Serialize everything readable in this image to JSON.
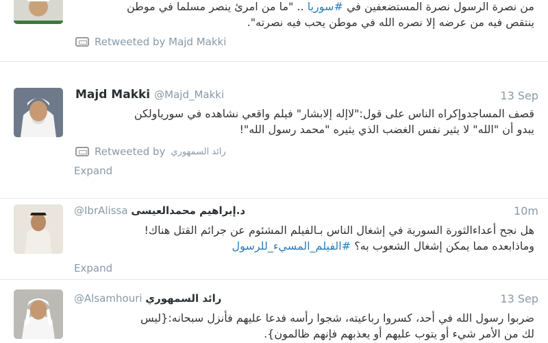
{
  "tweets": [
    {
      "line1_start": "من نصرة الرسول نصرة المستضعفين في ",
      "line1_tag": "#سوريا",
      "line1_end": " .. \"ما من امرئ ينصر مسلما في موطن",
      "line2": "ينتقص فيه من عرضه إلا نصره الله في موطن يحب فيه نصرته\".",
      "retweet_label": "Retweeted by Majd Makki"
    },
    {
      "name": "Majd Makki",
      "handle": "@Majd_Makki",
      "time": "13 Sep",
      "line1": "قصف المساجدوإكراه الناس على قول:\"لاإله إلابشار\" فيلم واقعي نشاهده في سورياولكن",
      "line2": "يبدو أن \"الله\" لا يثير نفس الغضب الذي يثيره \"محمد رسول الله\"!",
      "retweet_label_prefix": "Retweeted by",
      "retweet_label_name": "رائد السمهوري",
      "expand": "Expand"
    },
    {
      "name": "د.إبراهيم محمدالعيسى",
      "handle": "@IbrAlissa",
      "time": "10m",
      "line1": "هل نجح أعداءالثورة السورية في إشغال الناس بـالفيلم المشئوم عن جرائم القتل هناك!",
      "line2_start": "وماذابعده مما يمكن إشغال الشعوب به؟ ",
      "line2_tag": "#الفيلم_المسيء_للرسول",
      "expand": "Expand"
    },
    {
      "name": "رائد السمهوري",
      "handle": "@Alsamhouri",
      "time": "13 Sep",
      "line1": "ضربوا رسول الله في أحد، كسروا رباعيته، شجوا رأسه فدعا عليهم فأنزل سبحانه:{ليس",
      "line2": "لك من الأمر شيء أو يتوب عليهم أو يعذبهم فإنهم ظالمون}."
    }
  ],
  "colors": {
    "link": "#2b7bb9",
    "meta": "#8899a6",
    "divider": "#e1e8ed"
  }
}
